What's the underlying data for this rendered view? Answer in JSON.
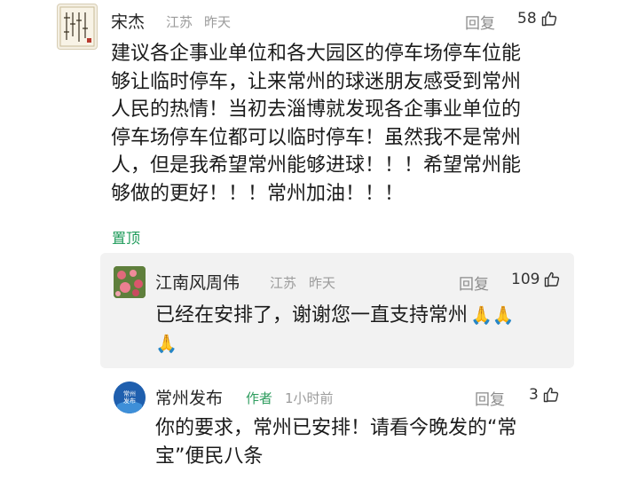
{
  "main_comment": {
    "user": "宋杰",
    "location": "江苏",
    "time": "昨天",
    "reply_label": "回复",
    "likes": "58",
    "lines": [
      "建议各企事业单位和各大园区的停车场停车位能",
      "够让临时停车，让来常州的球迷朋友感受到常州",
      "人民的热情！当初去淄博就发现各企事业单位的",
      "停车场停车位都可以临时停车！虽然我不是常州",
      "人，但是我希望常州能够进球！！！希望常州能",
      "够做的更好！！！常州加油！！！"
    ],
    "pinned_label": "置顶"
  },
  "reply_one": {
    "user": "江南风周伟",
    "location": "江苏",
    "time": "昨天",
    "reply_label": "回复",
    "likes": "109",
    "line1": "已经在安排了，谢谢您一直支持常州"
  },
  "reply_two": {
    "user": "常州发布",
    "author_tag": "作者",
    "time": "1小时前",
    "reply_label": "回复",
    "likes": "3",
    "lines": [
      "你的要求，常州已安排！请看今晚发的“常",
      "宝”便民八条"
    ],
    "avatar_text": "常州\n发布"
  },
  "icons": {
    "like": "thumbs-up-icon",
    "emoji": "praying-hands-emoji"
  },
  "colors": {
    "pinned": "#1e9b5a",
    "author_tag": "#2e9c5e",
    "avatar_blue": "#1f5fae"
  }
}
